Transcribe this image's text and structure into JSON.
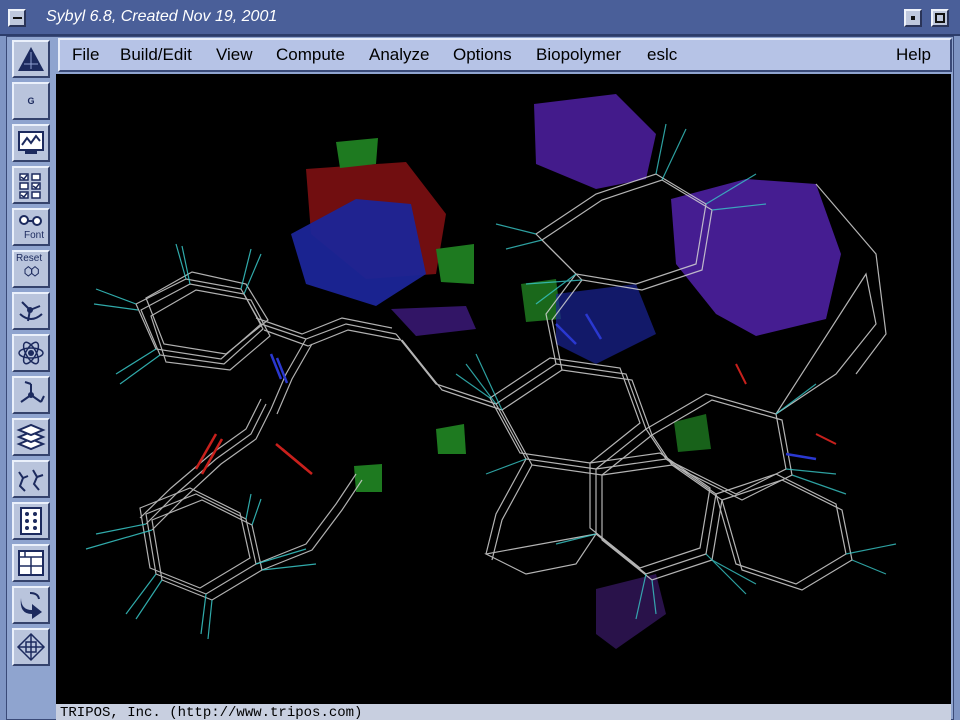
{
  "window": {
    "title": "Sybyl 6.8, Created Nov 19, 2001"
  },
  "menu": {
    "items": [
      "File",
      "Build/Edit",
      "View",
      "Compute",
      "Analyze",
      "Options",
      "Biopolymer",
      "eslc"
    ],
    "help": "Help"
  },
  "toolbar": {
    "tools": [
      {
        "icon": "sybyl-logo-icon"
      },
      {
        "icon": "g-icon",
        "label": "G"
      },
      {
        "icon": "monitor-icon"
      },
      {
        "icon": "checklist-icon"
      },
      {
        "icon": "font-icon",
        "label": "Font"
      },
      {
        "icon": "reset-icon",
        "label": "Reset"
      },
      {
        "icon": "molecule-rotate-icon"
      },
      {
        "icon": "atom-icon"
      },
      {
        "icon": "branch-icon"
      },
      {
        "icon": "layers-icon"
      },
      {
        "icon": "molecules-icon"
      },
      {
        "icon": "grid-dots-icon"
      },
      {
        "icon": "table-icon"
      },
      {
        "icon": "arrow-icon"
      },
      {
        "icon": "cube-icon"
      }
    ]
  },
  "status": {
    "text": "TRIPOS, Inc. (http://www.tripos.com)"
  },
  "colors": {
    "titlebar": "#4a5f99",
    "menubar": "#b6c3e6",
    "viewport": "#000000",
    "bond_white": "#d8d8d8",
    "bond_cyan": "#39c8c8",
    "contour_purple": "#4a1e9a",
    "contour_blue": "#1a2496",
    "contour_red": "#8a1010",
    "contour_green": "#1f7a1f"
  }
}
